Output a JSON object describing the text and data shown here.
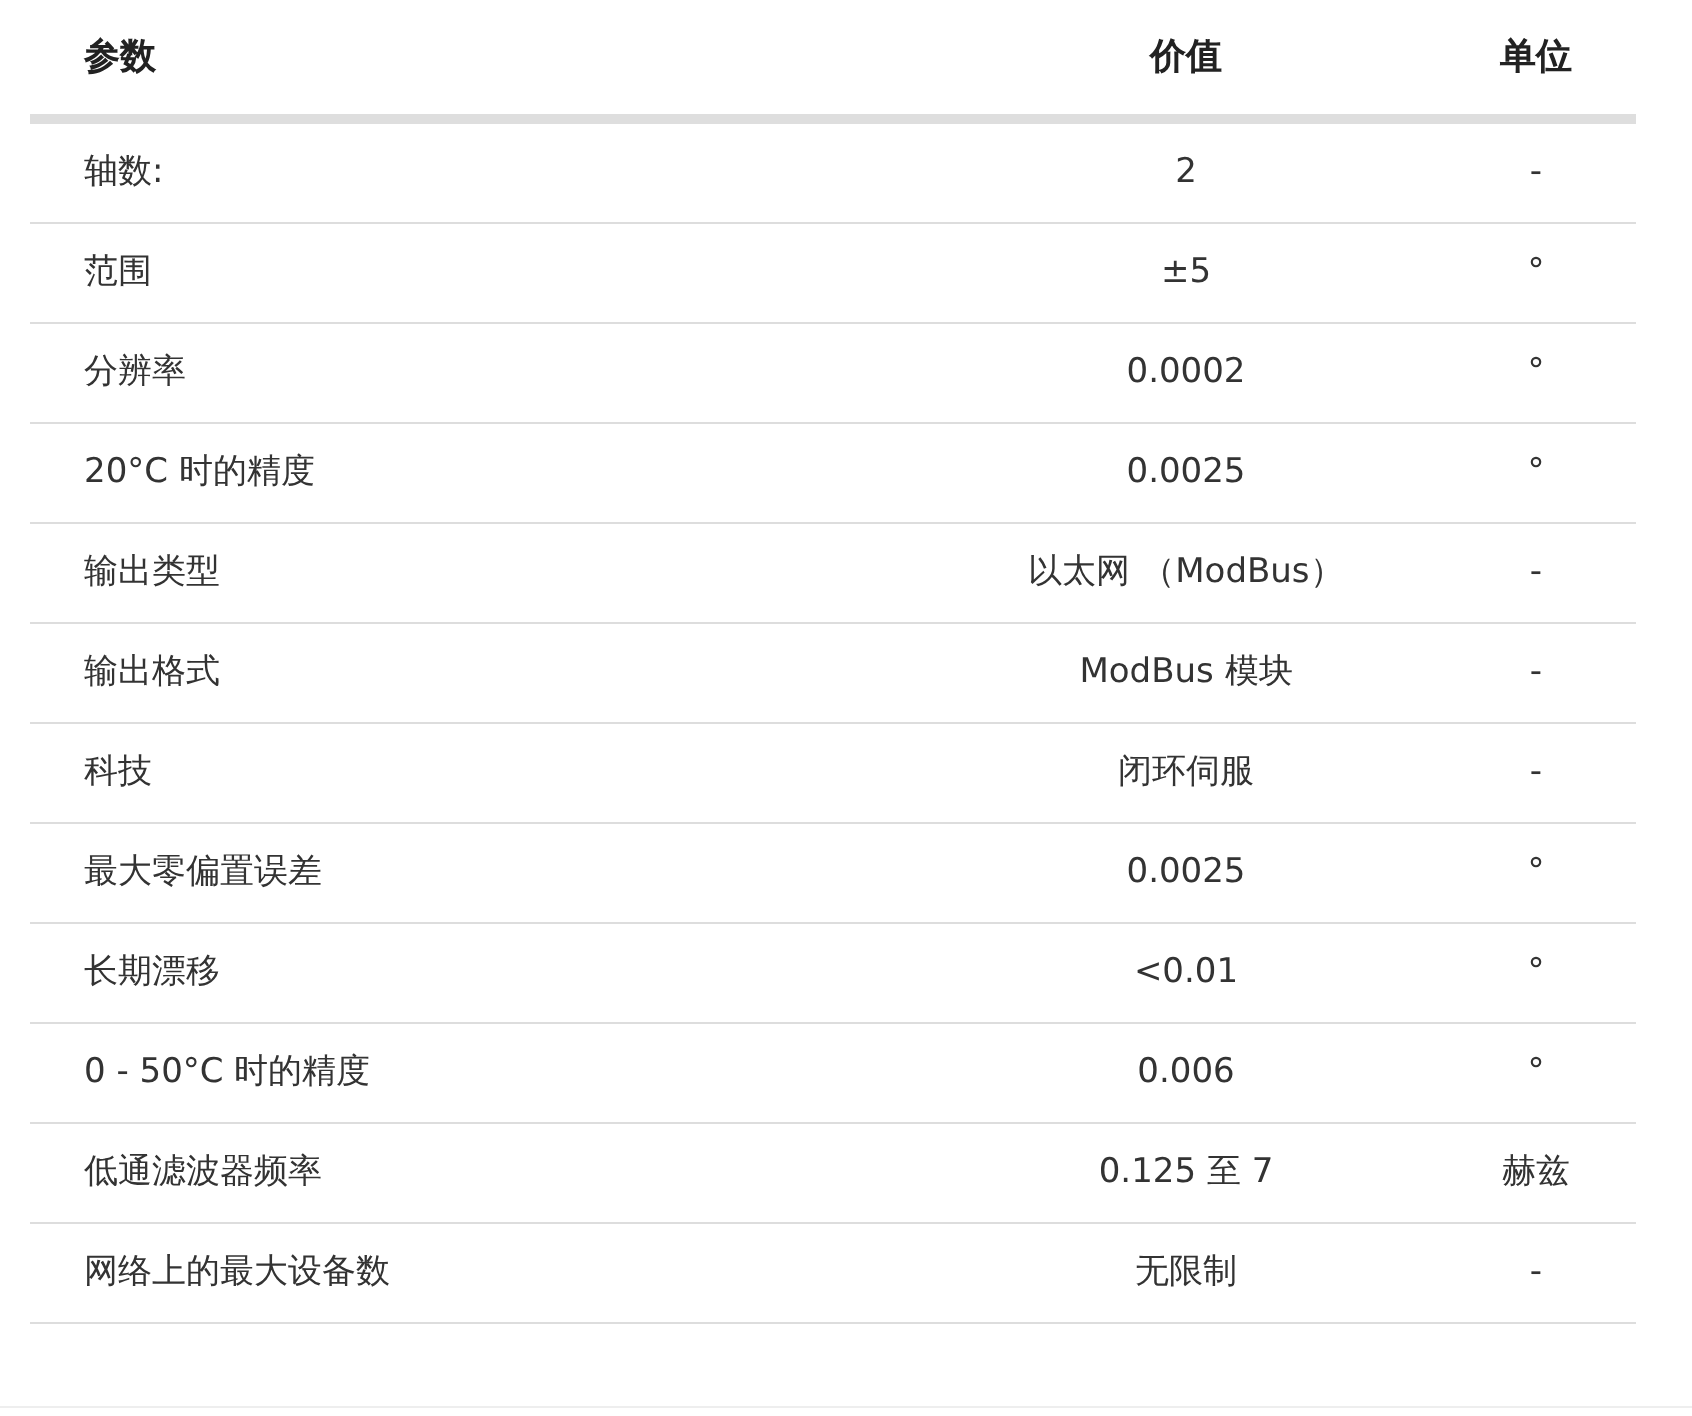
{
  "table": {
    "columns": [
      "参数",
      "价值",
      "单位"
    ],
    "rows": [
      [
        "轴数:",
        "2",
        "-"
      ],
      [
        "范围",
        "±5",
        "°"
      ],
      [
        "分辨率",
        "0.0002",
        "°"
      ],
      [
        "20°C 时的精度",
        "0.0025",
        "°"
      ],
      [
        "输出类型",
        "以太网 （ModBus）",
        "-"
      ],
      [
        "输出格式",
        "ModBus 模块",
        "-"
      ],
      [
        "科技",
        "闭环伺服",
        "-"
      ],
      [
        "最大零偏置误差",
        "0.0025",
        "°"
      ],
      [
        "长期漂移",
        "<0.01",
        "°"
      ],
      [
        "0 - 50°C 时的精度",
        "0.006",
        "°"
      ],
      [
        "低通滤波器频率",
        "0.125 至 7",
        "赫兹"
      ],
      [
        "网络上的最大设备数",
        "无限制",
        "-"
      ]
    ]
  }
}
